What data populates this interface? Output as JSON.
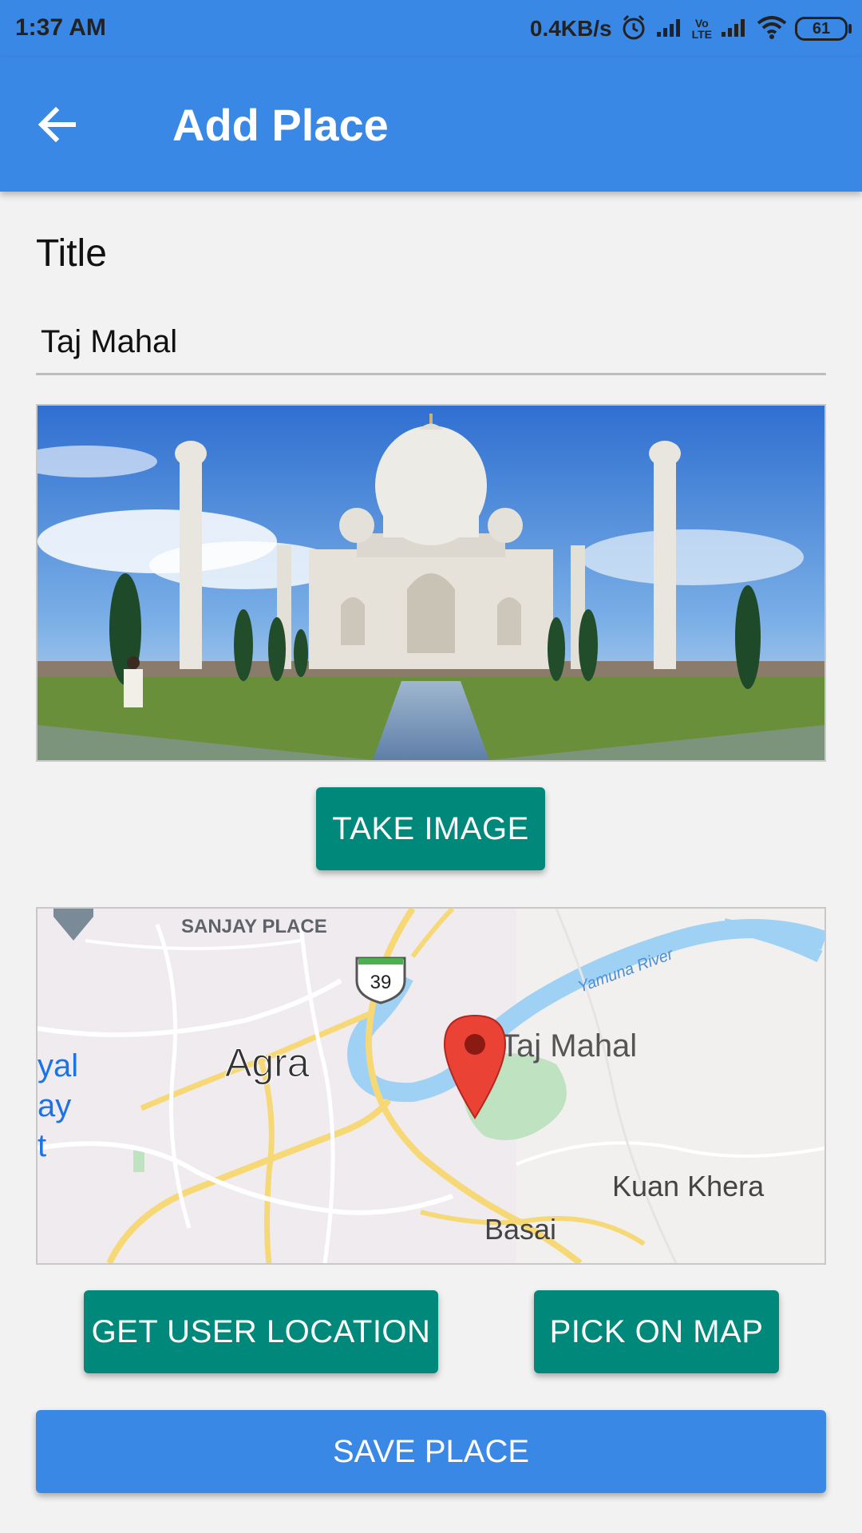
{
  "status_bar": {
    "time": "1:37 AM",
    "speed": "0.4KB/s",
    "volte_top": "Vo",
    "volte_bottom": "LTE",
    "battery": "61",
    "icons": [
      "alarm-icon",
      "signal-icon",
      "volte-icon",
      "signal-icon",
      "wifi-icon",
      "battery-icon"
    ]
  },
  "app_bar": {
    "title": "Add Place",
    "back_icon": "arrow-left-icon",
    "color": "#3a88e6"
  },
  "form": {
    "title_label": "Title",
    "title_value": "Taj Mahal"
  },
  "image_preview": {
    "subject": "Taj Mahal photo"
  },
  "buttons": {
    "take_image": "TAKE IMAGE",
    "get_user_location": "GET USER LOCATION",
    "pick_on_map": "PICK ON MAP",
    "save_place": "SAVE PLACE",
    "teal_color": "#00897b"
  },
  "map": {
    "labels": {
      "sanjay_place": "SANJAY PLACE",
      "agra": "Agra",
      "taj_mahal": "Taj Mahal",
      "yamuna_river": "Yamuna River",
      "kuan_khera": "Kuan Khera",
      "basai": "Basai",
      "route_shield": "39",
      "edge_1": "yal",
      "edge_2": "ay",
      "edge_3": "t"
    },
    "marker_icon": "map-pin-icon"
  }
}
